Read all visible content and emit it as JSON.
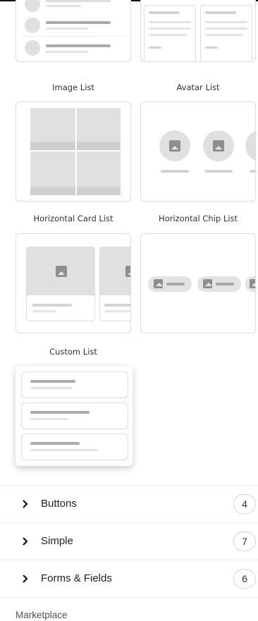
{
  "templates": {
    "image_list": "Image List",
    "avatar_list": "Avatar List",
    "horizontal_card_list": "Horizontal Card List",
    "horizontal_chip_list": "Horizontal Chip List",
    "custom_list": "Custom List"
  },
  "sections": [
    {
      "label": "Buttons",
      "count": "4"
    },
    {
      "label": "Simple",
      "count": "7"
    },
    {
      "label": "Forms & Fields",
      "count": "6"
    }
  ],
  "footer": {
    "marketplace": "Marketplace"
  },
  "icons": {
    "chevron": "chevron-right-icon",
    "image": "image-icon"
  }
}
